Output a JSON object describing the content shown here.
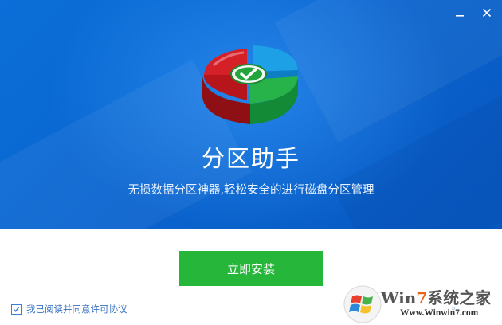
{
  "window": {
    "minimize_icon": "minimize-icon",
    "close_icon": "close-icon"
  },
  "hero": {
    "title": "分区助手",
    "subtitle": "无损数据分区神器,轻松安全的进行磁盘分区管理"
  },
  "install_button": {
    "label": "立即安装"
  },
  "agreement": {
    "checked": true,
    "label": "我已阅读并同意许可协议"
  },
  "watermark": {
    "brand_a": "Win",
    "brand_b": "7",
    "brand_c": "系统之家",
    "url": "Www.Winwin7.com",
    "more": "»"
  },
  "colors": {
    "accent": "#0a64cf",
    "install": "#26b63a",
    "link": "#3a72c2"
  }
}
